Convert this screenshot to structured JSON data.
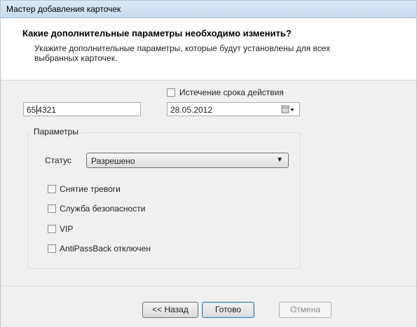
{
  "window": {
    "title": "Мастер добавления карточек"
  },
  "header": {
    "title": "Какие дополнительные параметры необходимо изменить?",
    "subtitle": "Укажите дополнительные параметры, которые будут установлены для всех выбранных карточек."
  },
  "form": {
    "card_number_before_caret": "65",
    "card_number_after_caret": "4321",
    "expiry_checkbox_label": "Истечение срока действия",
    "expiry_checked": false,
    "expiry_date": "28.05.2012",
    "calendar_icon": "calendar-icon"
  },
  "params": {
    "group_title": "Параметры",
    "status_label": "Статус",
    "status_value": "Разрешено",
    "checkboxes": [
      {
        "label": "Снятие тревоги",
        "checked": false
      },
      {
        "label": "Служба безопасности",
        "checked": false
      },
      {
        "label": "VIP",
        "checked": false
      },
      {
        "label": "AntiPassBack отключен",
        "checked": false
      }
    ]
  },
  "footer": {
    "back_label": "<< Назад",
    "finish_label": "Готово",
    "cancel_label": "Отмена"
  }
}
